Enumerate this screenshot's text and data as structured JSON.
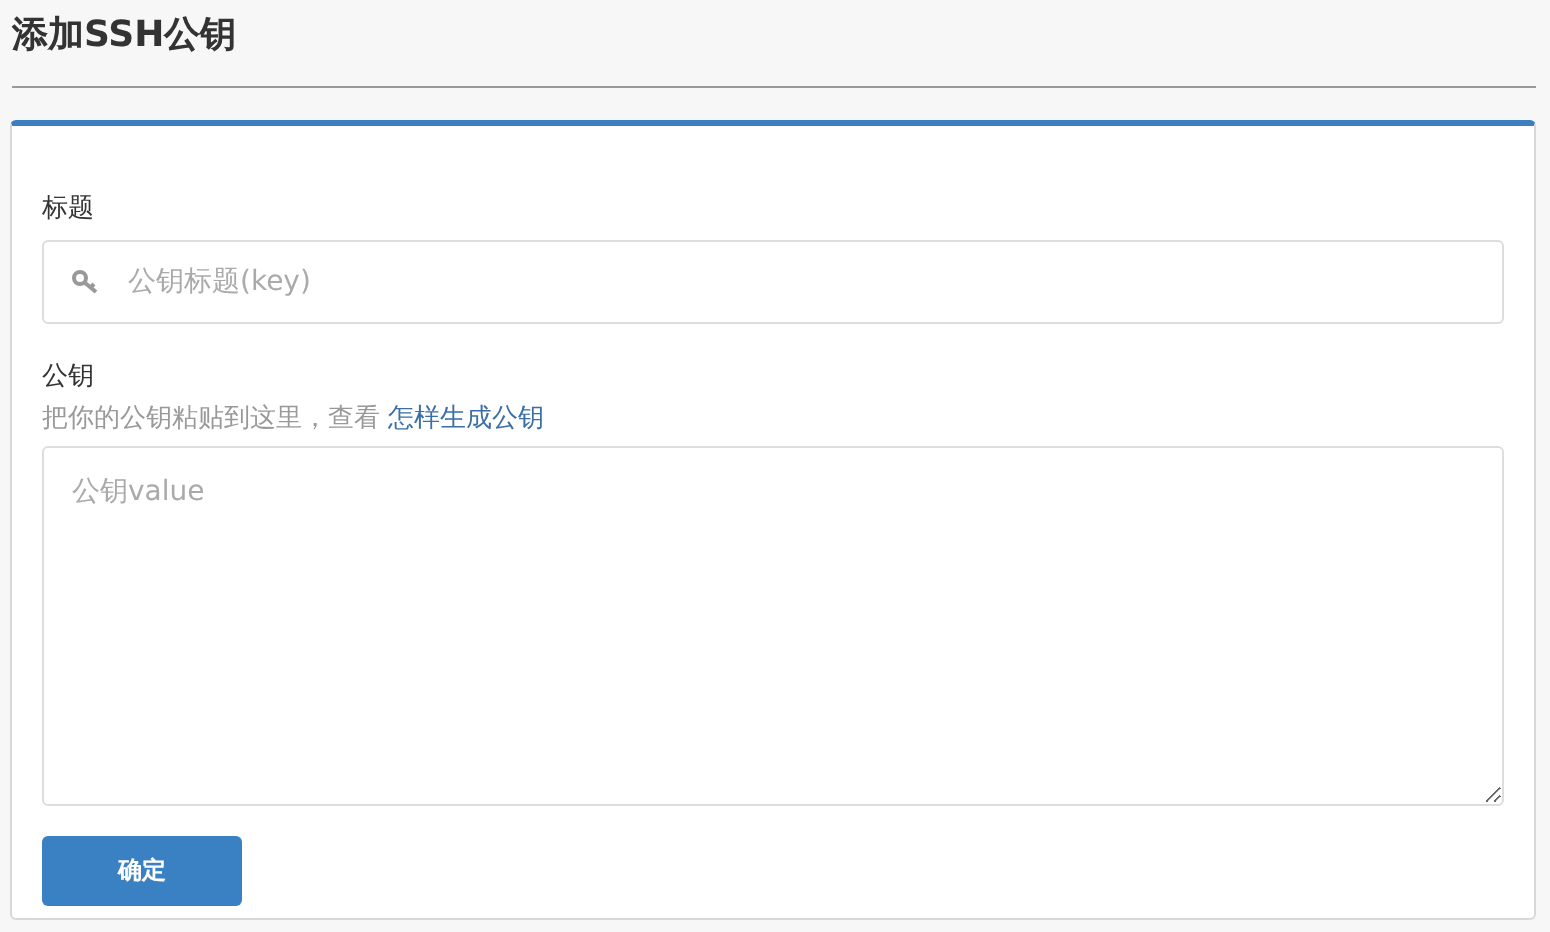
{
  "page_title": "添加SSH公钥",
  "form": {
    "title_field": {
      "label": "标题",
      "placeholder": "公钥标题(key)"
    },
    "key_field": {
      "label": "公钥",
      "help": "把你的公钥粘贴到这里，查看",
      "help_link": "怎样生成公钥",
      "placeholder": "公钥value"
    },
    "submit": "确定"
  }
}
